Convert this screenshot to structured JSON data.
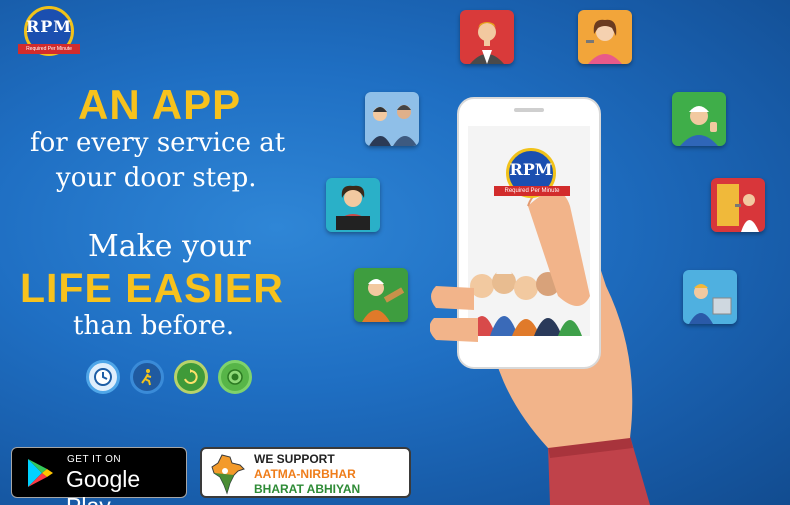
{
  "brand": {
    "monogram": "RPM",
    "tagline": "Required Per Minute",
    "accent": "#f7c21d",
    "ribbon": "#d22c2c"
  },
  "hero": {
    "headline": "AN APP",
    "line1": "for every service at",
    "line2": "your door step.",
    "make": "Make your",
    "life": "LIFE EASIER",
    "than": "than before."
  },
  "feature_badges": [
    "clock-icon",
    "person-running-icon",
    "leaf-refresh-icon",
    "medal-icon"
  ],
  "store": {
    "get_it_on": "GET IT ON",
    "name": "Google Play"
  },
  "support": {
    "we_support": "WE SUPPORT",
    "aatma": "AATMA-NIRBHAR",
    "bharat": "BHARAT ABHIYAN"
  },
  "service_icons": [
    "businessman-icon",
    "woman-chef-icon",
    "couple-workers-icon",
    "plumber-thumbsup-icon",
    "receptionist-icon",
    "painter-icon",
    "carpenter-icon",
    "mechanic-icon"
  ]
}
